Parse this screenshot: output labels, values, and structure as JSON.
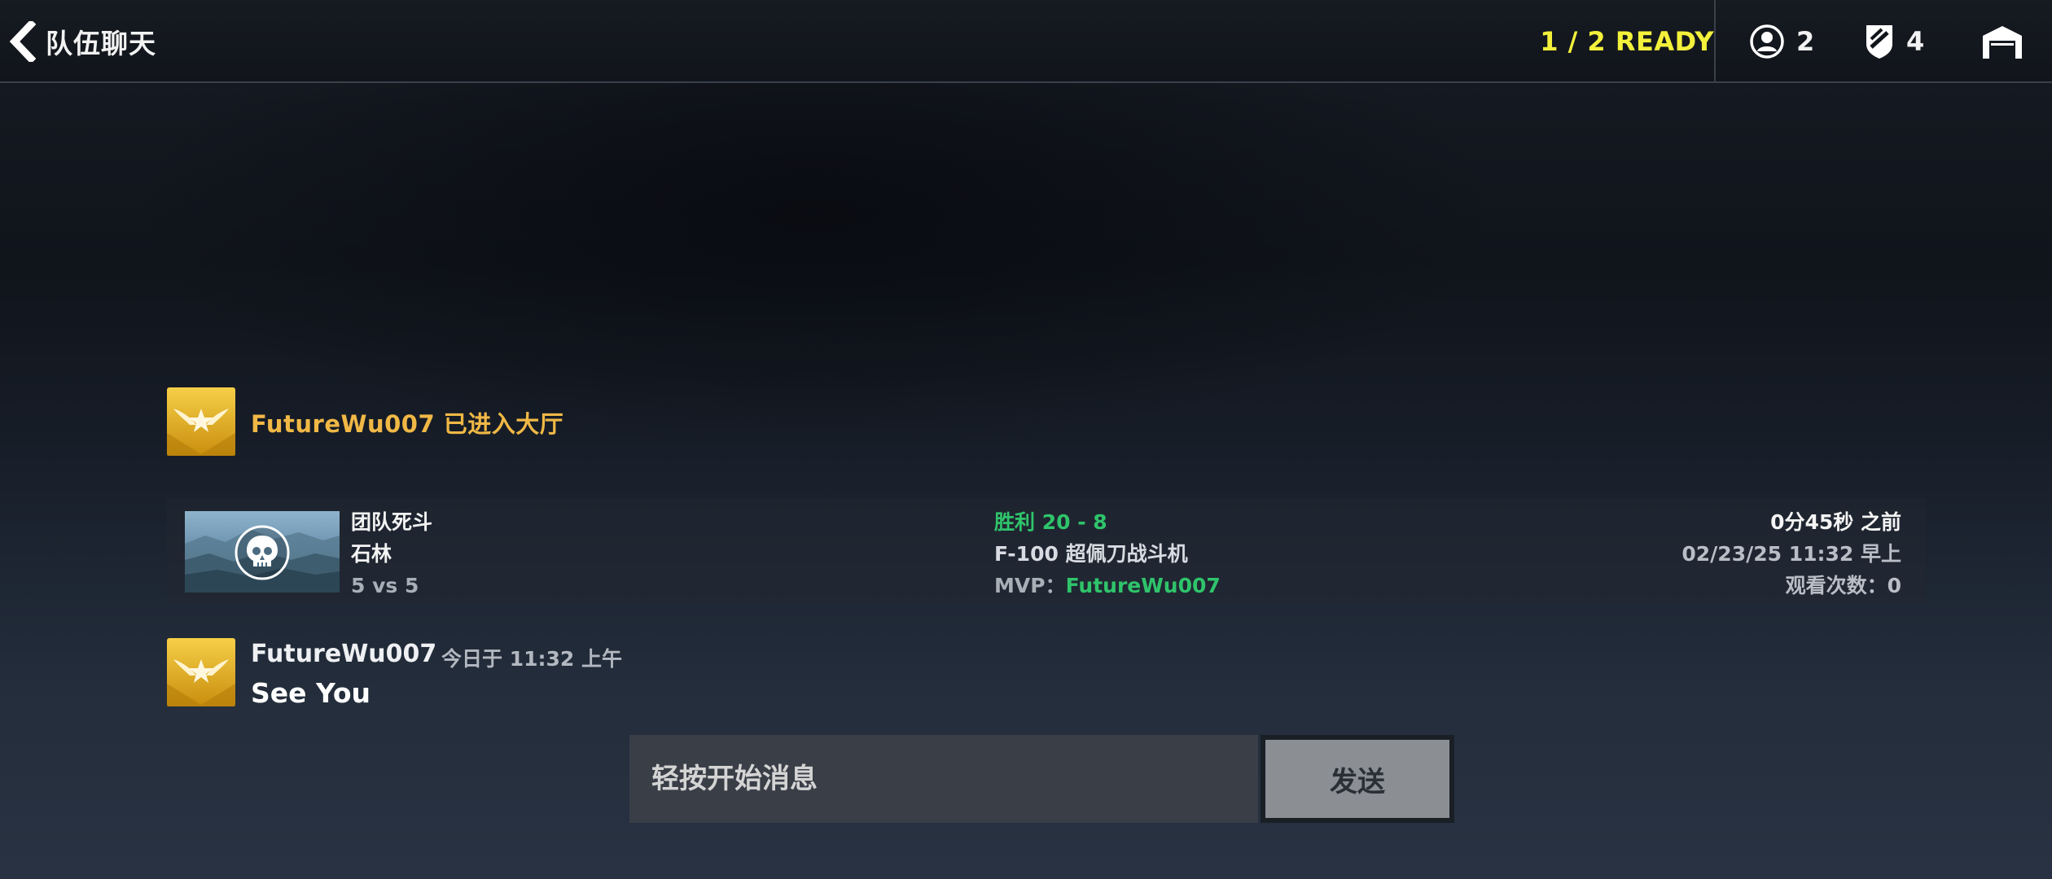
{
  "header": {
    "back_label": "队伍聊天",
    "ready_status": "1 / 2 READY",
    "player_count": "2",
    "rank_count": "4"
  },
  "system_message": "FutureWu007 已进入大厅",
  "match_card": {
    "mode": "团队死斗",
    "map": "石林",
    "team_size": "5 vs 5",
    "result": "胜利 20 - 8",
    "aircraft": "F-100 超佩刀战斗机",
    "mvp_label": "MVP：",
    "mvp_name": "FutureWu007",
    "time_ago": "0分45秒 之前",
    "datetime": "02/23/25 11:32 早上",
    "views": "观看次数：0"
  },
  "chat_message": {
    "user": "FutureWu007",
    "time": "今日于 11:32 上午",
    "text": "See You"
  },
  "input": {
    "placeholder": "轻按开始消息",
    "send_label": "发送"
  },
  "icons": {
    "back": "chevron-left-icon",
    "players": "user-circle-icon",
    "rank": "shield-icon",
    "hangar": "hangar-icon",
    "badge": "gold-wings-star-icon",
    "mode": "skull-icon"
  },
  "colors": {
    "ready": "#f3f13b",
    "system_message": "#f0b845",
    "win": "#2fc46b",
    "badge_gold": "#e6b320"
  }
}
